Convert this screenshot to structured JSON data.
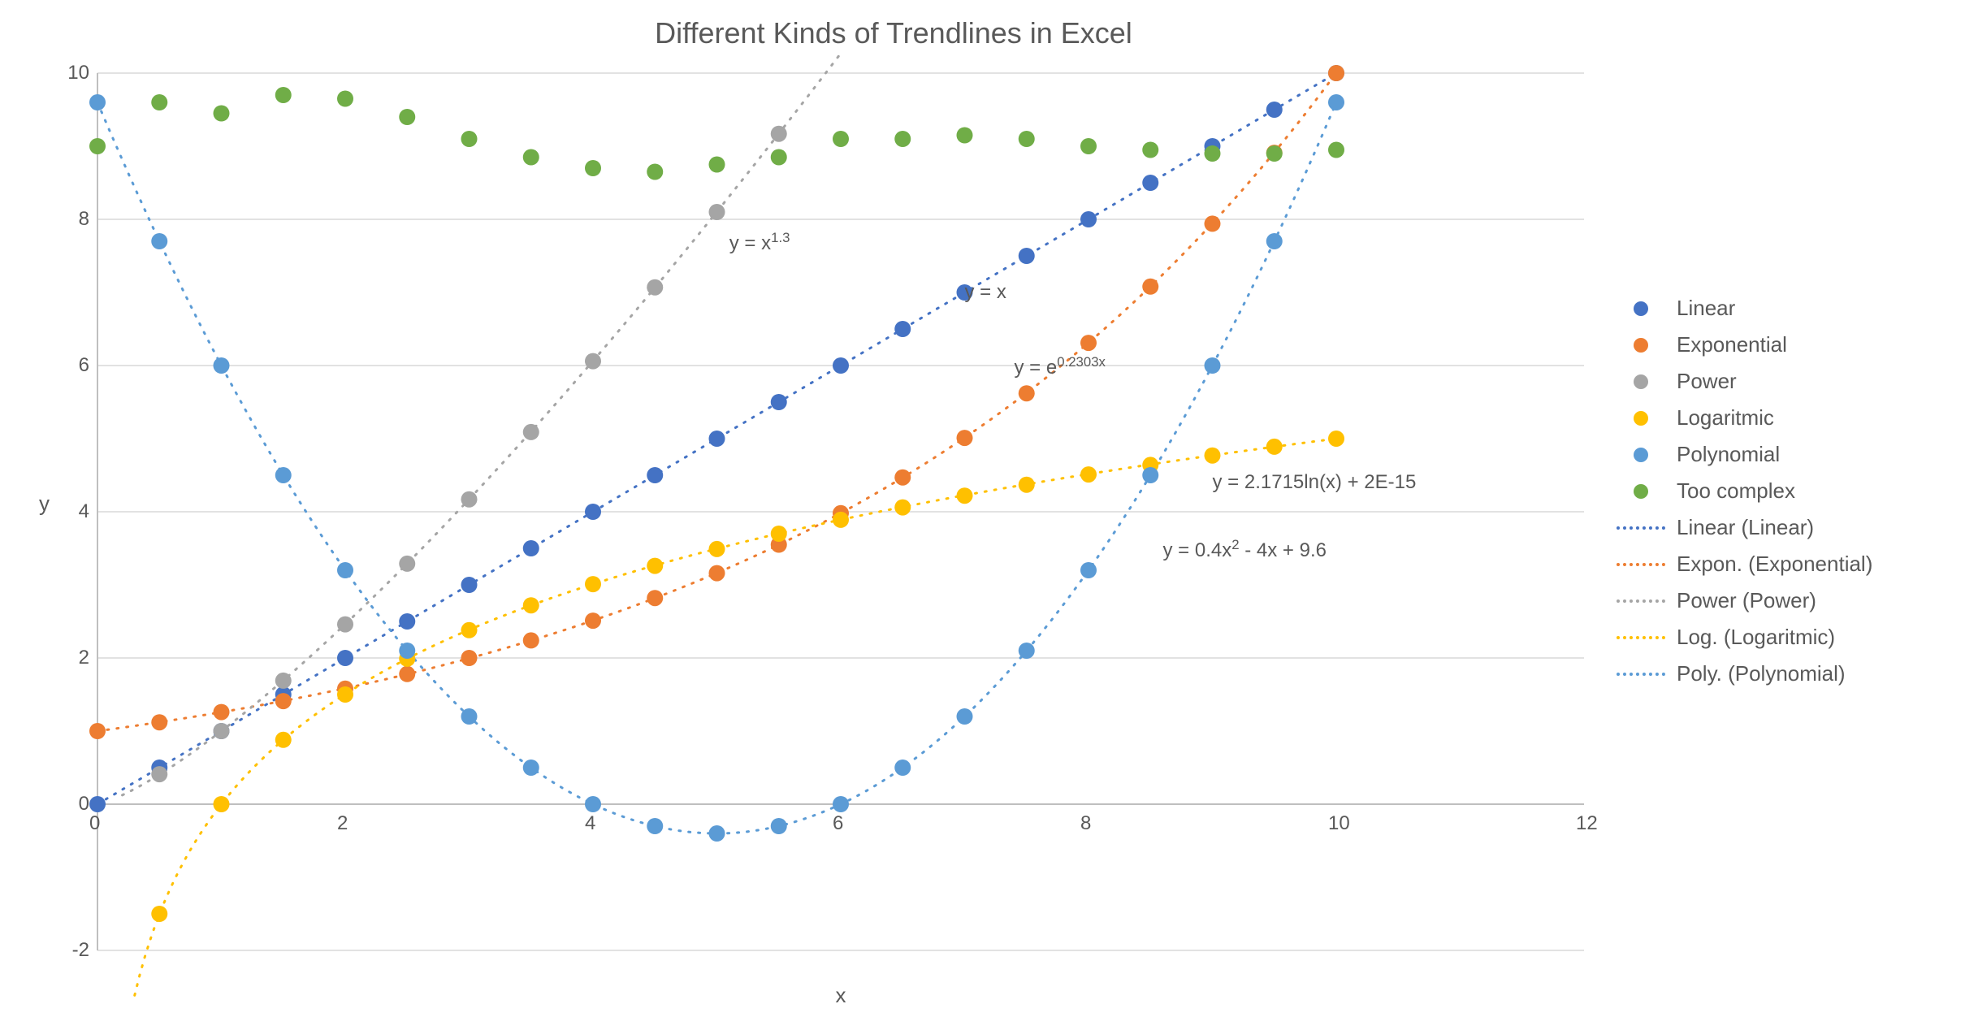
{
  "chart_data": {
    "type": "scatter",
    "title": "Different Kinds of Trendlines in Excel",
    "xlabel": "x",
    "ylabel": "y",
    "xlim": [
      0,
      12
    ],
    "ylim": [
      -2,
      10
    ],
    "x_ticks": [
      0,
      2,
      4,
      6,
      8,
      10,
      12
    ],
    "y_ticks": [
      -2,
      0,
      2,
      4,
      6,
      8,
      10
    ],
    "grid": true,
    "legend_position": "right",
    "x": [
      0,
      0.5,
      1,
      1.5,
      2,
      2.5,
      3,
      3.5,
      4,
      4.5,
      5,
      5.5,
      6,
      6.5,
      7,
      7.5,
      8,
      8.5,
      9,
      9.5,
      10
    ],
    "series": [
      {
        "name": "Linear",
        "color": "#4472C4",
        "marker": "dot",
        "values": [
          0,
          0.5,
          1,
          1.5,
          2,
          2.5,
          3,
          3.5,
          4,
          4.5,
          5,
          5.5,
          6,
          6.5,
          7,
          7.5,
          8,
          8.5,
          9,
          9.5,
          10
        ]
      },
      {
        "name": "Exponential",
        "color": "#ED7D31",
        "marker": "dot",
        "values": [
          1,
          1.12,
          1.26,
          1.41,
          1.58,
          1.78,
          2.0,
          2.24,
          2.51,
          2.82,
          3.16,
          3.55,
          3.98,
          4.47,
          5.01,
          5.62,
          6.31,
          7.08,
          7.94,
          8.91,
          10.0
        ]
      },
      {
        "name": "Power",
        "color": "#A5A5A5",
        "marker": "dot",
        "values": [
          null,
          0.41,
          1.0,
          1.69,
          2.46,
          3.29,
          4.17,
          5.09,
          6.06,
          7.07,
          8.1,
          9.17,
          null,
          null,
          null,
          null,
          null,
          null,
          null,
          null,
          null
        ]
      },
      {
        "name": "Logaritmic",
        "color": "#FFC000",
        "marker": "dot",
        "values": [
          null,
          -1.5,
          0.0,
          0.88,
          1.5,
          1.99,
          2.38,
          2.72,
          3.01,
          3.26,
          3.49,
          3.7,
          3.89,
          4.06,
          4.22,
          4.37,
          4.51,
          4.64,
          4.77,
          4.89,
          5.0
        ]
      },
      {
        "name": "Polynomial",
        "color": "#5B9BD5",
        "marker": "dot",
        "values": [
          9.6,
          7.7,
          6.0,
          4.5,
          3.2,
          2.1,
          1.2,
          0.5,
          0.0,
          -0.3,
          -0.4,
          -0.3,
          0.0,
          0.5,
          1.2,
          2.1,
          3.2,
          4.5,
          6.0,
          7.7,
          9.6
        ]
      },
      {
        "name": "Too complex",
        "color": "#70AD47",
        "marker": "dot",
        "values": [
          9.0,
          9.6,
          9.45,
          9.7,
          9.65,
          9.4,
          9.1,
          8.85,
          8.7,
          8.65,
          8.75,
          8.85,
          9.1,
          9.1,
          9.15,
          9.1,
          9.0,
          8.95,
          8.9,
          8.9,
          8.95
        ]
      }
    ],
    "trendlines": [
      {
        "name": "Linear (Linear)",
        "color": "#4472C4",
        "equation": "y = x",
        "equation_pos": {
          "x": 7.0,
          "y": 7.0
        }
      },
      {
        "name": "Expon. (Exponential)",
        "color": "#ED7D31",
        "equation": "y = e^{0.2303x}",
        "equation_pos": {
          "x": 7.4,
          "y": 6.0
        }
      },
      {
        "name": "Power (Power)",
        "color": "#A5A5A5",
        "equation": "y = x^{1.3}",
        "equation_pos": {
          "x": 5.1,
          "y": 7.7
        }
      },
      {
        "name": "Log. (Logaritmic)",
        "color": "#FFC000",
        "equation": "y = 2.1715ln(x) + 2E-15",
        "equation_pos": {
          "x": 9.0,
          "y": 4.4
        }
      },
      {
        "name": "Poly. (Polynomial)",
        "color": "#5B9BD5",
        "equation": "y = 0.4x^{2} - 4x + 9.6",
        "equation_pos": {
          "x": 8.6,
          "y": 3.5
        }
      }
    ],
    "legend": [
      {
        "type": "marker",
        "label": "Linear",
        "color": "#4472C4"
      },
      {
        "type": "marker",
        "label": "Exponential",
        "color": "#ED7D31"
      },
      {
        "type": "marker",
        "label": "Power",
        "color": "#A5A5A5"
      },
      {
        "type": "marker",
        "label": "Logaritmic",
        "color": "#FFC000"
      },
      {
        "type": "marker",
        "label": "Polynomial",
        "color": "#5B9BD5"
      },
      {
        "type": "marker",
        "label": "Too complex",
        "color": "#70AD47"
      },
      {
        "type": "line",
        "label": "Linear (Linear)",
        "color": "#4472C4"
      },
      {
        "type": "line",
        "label": "Expon. (Exponential)",
        "color": "#ED7D31"
      },
      {
        "type": "line",
        "label": "Power (Power)",
        "color": "#A5A5A5"
      },
      {
        "type": "line",
        "label": "Log. (Logaritmic)",
        "color": "#FFC000"
      },
      {
        "type": "line",
        "label": "Poly. (Polynomial)",
        "color": "#5B9BD5"
      }
    ]
  }
}
